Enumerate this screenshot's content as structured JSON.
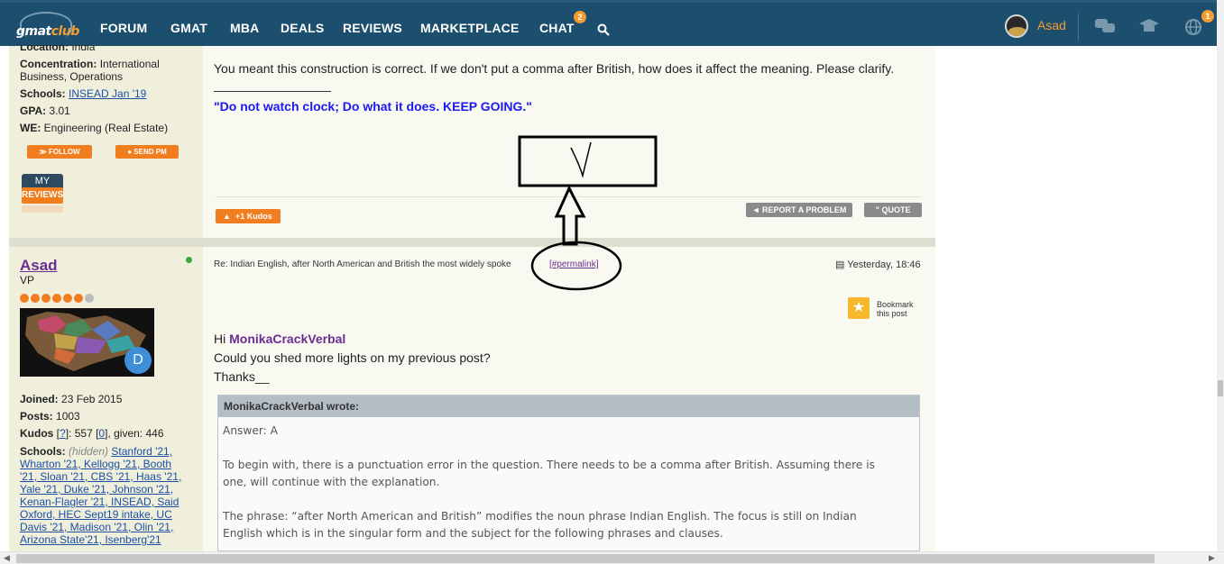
{
  "nav": {
    "logo_text": "gmat",
    "logo_text_accent": "club",
    "items": [
      "FORUM",
      "GMAT",
      "MBA",
      "DEALS",
      "REVIEWS",
      "MARKETPLACE",
      "CHAT"
    ],
    "chat_badge": "2",
    "user_name": "Asad",
    "notification_badge": "1"
  },
  "prev_post": {
    "location_label": "Location:",
    "location_value": "India",
    "concentration_label": "Concentration:",
    "concentration_value_1": "International",
    "concentration_value_2": "Business, Operations",
    "schools_label": "Schools:",
    "schools_value": "INSEAD Jan '19",
    "gpa_label": "GPA:",
    "gpa_value": "3.01",
    "we_label": "WE:",
    "we_value": "Engineering (Real Estate)",
    "follow": "FOLLOW",
    "send_pm": "SEND PM",
    "my": "MY",
    "reviews": "REVIEWS",
    "text": "You meant this construction is correct. If we don't put a comma after British, how does it affect the meaning. Please clarify.",
    "signature": "\"Do not watch clock; Do what it does. KEEP GOING.\"",
    "kudos": "+1 Kudos",
    "report": "REPORT A PROBLEM",
    "quote": "QUOTE"
  },
  "post": {
    "author": "Asad",
    "rank": "VP",
    "avatar_letter": "D",
    "joined_label": "Joined:",
    "joined_value": "23 Feb 2015",
    "posts_label": "Posts:",
    "posts_value": "1003",
    "kudos_label": "Kudos",
    "kudos_q": "?",
    "kudos_received": "557",
    "kudos_zero": "0",
    "kudos_given": ", given: 446",
    "schools_label": "Schools:",
    "schools_hidden": "(hidden)",
    "schools_lines": [
      "Stanford '21,",
      "Wharton '21, Kellogg '21, Booth",
      "'21, Sloan '21, CBS '21, Haas '21,",
      "Yale '21, Duke '21, Johnson '21,",
      "Kenan-Flagler '21, INSEAD, Said",
      "Oxford, HEC Sept19 intake, UC",
      "Davis '21, Madison '21, Olin '21,",
      "Arizona State'21, Isenberg'21"
    ],
    "subject": "Re: Indian English, after North American and British the most widely spoke",
    "permalink": "[#permalink]",
    "date": "Yesterday, 18:46",
    "bookmark_1": "Bookmark",
    "bookmark_2": "this post",
    "greeting": "Hi ",
    "mention": "MonikaCrackVerbal",
    "line2": "Could you shed more lights on my previous post?",
    "line3": "Thanks__",
    "quote_header": "MonikaCrackVerbal wrote:",
    "quote_lines": [
      "Answer: A",
      "",
      "To begin with, there is a punctuation error in the question. There needs to be a comma after British. Assuming there is",
      "one, will continue with the explanation.",
      "",
      "The phrase: “after North American and British” modifies the noun phrase Indian English. The focus is still on Indian",
      "English which is in the singular form and the subject for the following phrases and clauses."
    ]
  },
  "colors": {
    "nav_bg": "#1c4f6e",
    "accent_orange": "#f07d1e",
    "sig_blue": "#1a1af0",
    "author_purple": "#6a2d91"
  }
}
